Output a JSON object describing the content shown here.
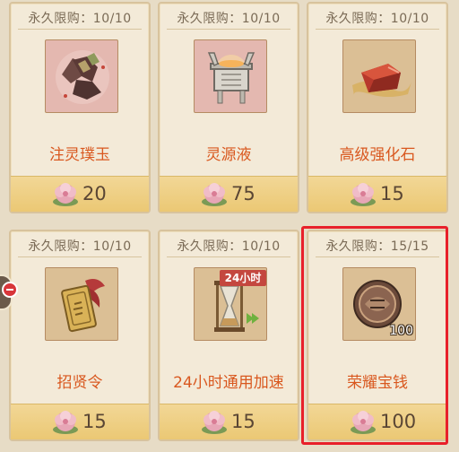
{
  "items": [
    {
      "limit": "永久限购：10/10",
      "name": "注灵璞玉",
      "price": "20",
      "icon": "jade-ore-icon"
    },
    {
      "limit": "永久限购：10/10",
      "name": "灵源液",
      "price": "75",
      "icon": "cauldron-icon"
    },
    {
      "limit": "永久限购：10/10",
      "name": "高级强化石",
      "price": "15",
      "icon": "enhance-stone-icon"
    },
    {
      "limit": "永久限购：10/10",
      "name": "招贤令",
      "price": "15",
      "icon": "token-plaque-icon"
    },
    {
      "limit": "永久限购：10/10",
      "name": "24小时通用加速",
      "price": "15",
      "icon": "hourglass-icon",
      "badge": "24小时"
    },
    {
      "limit": "永久限购：15/15",
      "name": "荣耀宝钱",
      "price": "100",
      "icon": "honor-coin-icon",
      "quantity": "100"
    }
  ],
  "colors": {
    "accent": "#d9581f",
    "selected": "#e8202a",
    "price_bar": "#ebc874"
  },
  "selected_index": 5
}
